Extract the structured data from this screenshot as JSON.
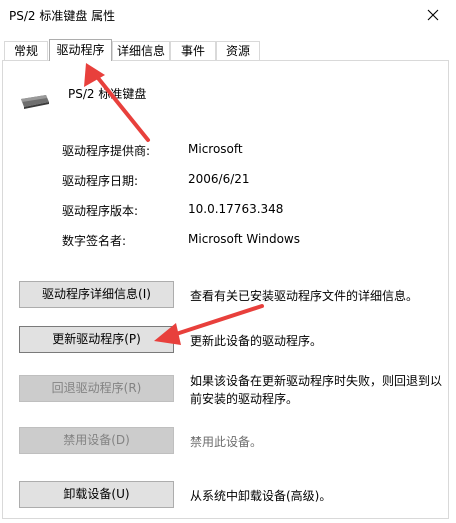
{
  "window": {
    "title": "PS/2 标准键盘 属性"
  },
  "tabs": [
    {
      "label": "常规"
    },
    {
      "label": "驱动程序"
    },
    {
      "label": "详细信息"
    },
    {
      "label": "事件"
    },
    {
      "label": "资源"
    }
  ],
  "device": {
    "name": "PS/2 标准键盘",
    "icon": "keyboard-icon"
  },
  "info": [
    {
      "label": "驱动程序提供商:",
      "value": "Microsoft"
    },
    {
      "label": "驱动程序日期:",
      "value": "2006/6/21"
    },
    {
      "label": "驱动程序版本:",
      "value": "10.0.17763.348"
    },
    {
      "label": "数字签名者:",
      "value": "Microsoft Windows"
    }
  ],
  "actions": [
    {
      "button": "驱动程序详细信息(I)",
      "description": "查看有关已安装驱动程序文件的详细信息。",
      "enabled": true
    },
    {
      "button": "更新驱动程序(P)",
      "description": "更新此设备的驱动程序。",
      "enabled": true
    },
    {
      "button": "回退驱动程序(R)",
      "description": "如果该设备在更新驱动程序时失败，则回退到以前安装的驱动程序。",
      "enabled": false
    },
    {
      "button": "禁用设备(D)",
      "description": "禁用此设备。",
      "enabled": false
    },
    {
      "button": "卸载设备(U)",
      "description": "从系统中卸载设备(高级)。",
      "enabled": true
    }
  ],
  "annotations": {
    "arrow_color": "#e8403c"
  }
}
